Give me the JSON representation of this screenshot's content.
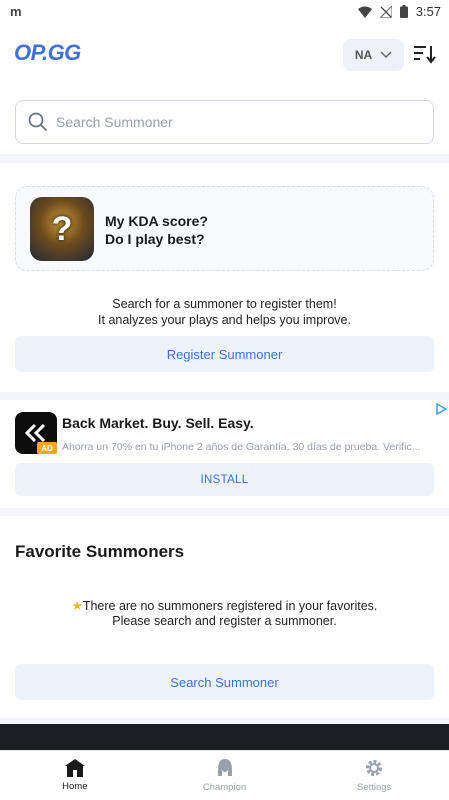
{
  "status_bar": {
    "time": "3:57",
    "app_glyph": "m"
  },
  "header": {
    "logo": "OP.GG",
    "region": "NA"
  },
  "search": {
    "placeholder": "Search Summoner"
  },
  "kda_card": {
    "line1": "My KDA score?",
    "line2": "Do I play best?",
    "avatar_glyph": "?",
    "desc_line1": "Search for a summoner to register them!",
    "desc_line2": "It analyzes your plays and helps you improve.",
    "register_label": "Register Summoner"
  },
  "ad": {
    "title": "Back Market. Buy. Sell. Easy.",
    "body": "Ahorra un 70% en tu iPhone 2 años de Garantía. 30 días de prueba. Verific...",
    "badge": "AD",
    "install_label": "INSTALL"
  },
  "favorites": {
    "title": "Favorite Summoners",
    "empty_line1": "There are no summoners registered in your favorites.",
    "empty_line2": "Please search and register a summoner.",
    "search_label": "Search Summoner"
  },
  "bottom_nav": {
    "items": [
      {
        "label": "Home",
        "icon": "home-icon"
      },
      {
        "label": "Champion",
        "icon": "champion-icon"
      },
      {
        "label": "Settings",
        "icon": "gear-icon"
      }
    ]
  },
  "colors": {
    "accent": "#4171d6",
    "button_bg": "#eef2fb",
    "star": "#f5b32a"
  }
}
